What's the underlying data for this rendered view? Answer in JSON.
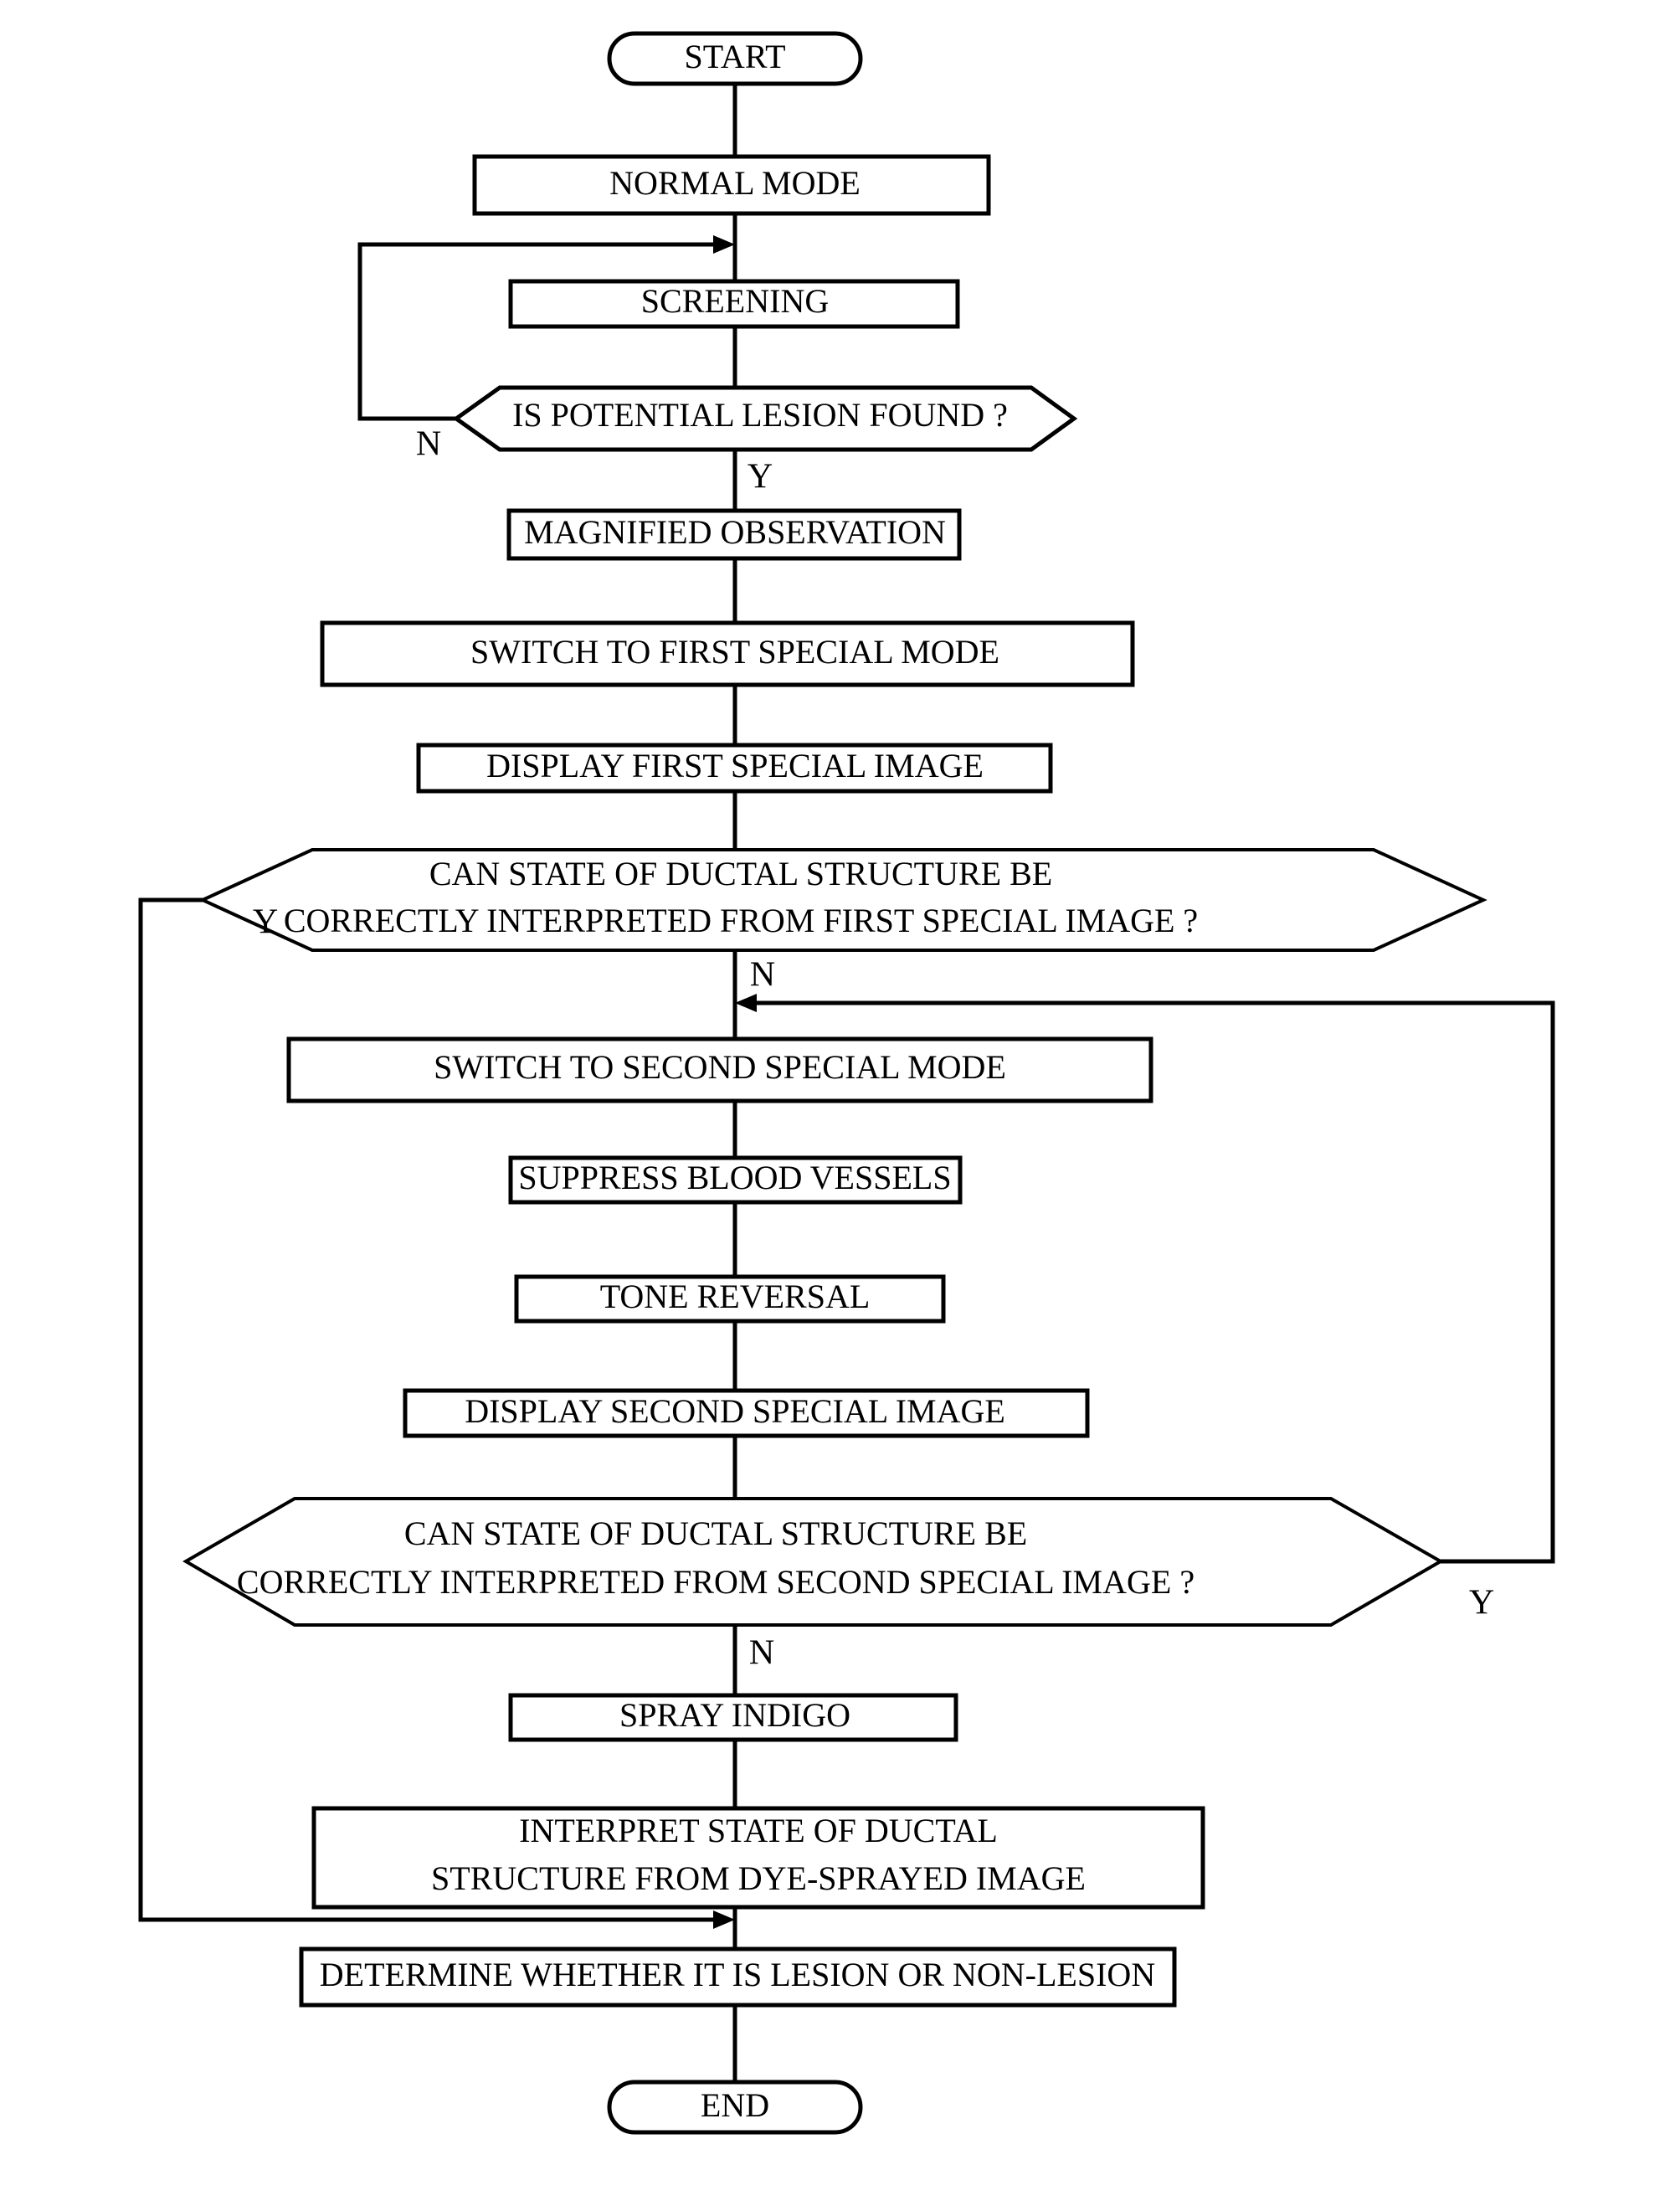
{
  "diagram": {
    "type": "flowchart",
    "title": "",
    "orientation": "top-to-bottom",
    "nodes": {
      "start": {
        "label": "START",
        "shape": "terminator"
      },
      "normal_mode": {
        "label": "NORMAL MODE",
        "shape": "process"
      },
      "screening": {
        "label": "SCREENING",
        "shape": "process"
      },
      "lesion_found": {
        "label": "IS POTENTIAL LESION FOUND ?",
        "shape": "decision"
      },
      "magnified": {
        "label": "MAGNIFIED OBSERVATION",
        "shape": "process"
      },
      "switch_first": {
        "label": "SWITCH TO FIRST SPECIAL MODE",
        "shape": "process"
      },
      "display_first": {
        "label": "DISPLAY FIRST SPECIAL IMAGE",
        "shape": "process"
      },
      "decide_first_l1": {
        "label": "CAN STATE OF DUCTAL STRUCTURE BE",
        "shape": "decision"
      },
      "decide_first_l2": {
        "label": "CORRECTLY INTERPRETED FROM FIRST SPECIAL IMAGE ?",
        "shape": "decision"
      },
      "switch_second": {
        "label": "SWITCH TO SECOND SPECIAL MODE",
        "shape": "process"
      },
      "suppress_vessels": {
        "label": "SUPPRESS BLOOD VESSELS",
        "shape": "process"
      },
      "tone_reversal": {
        "label": "TONE REVERSAL",
        "shape": "process"
      },
      "display_second": {
        "label": "DISPLAY SECOND SPECIAL IMAGE",
        "shape": "process"
      },
      "decide_second_l1": {
        "label": "CAN STATE OF DUCTAL STRUCTURE BE",
        "shape": "decision"
      },
      "decide_second_l2": {
        "label": "CORRECTLY INTERPRETED FROM SECOND SPECIAL IMAGE ?",
        "shape": "decision"
      },
      "spray_indigo": {
        "label": "SPRAY INDIGO",
        "shape": "process"
      },
      "interpret_l1": {
        "label": "INTERPRET STATE OF DUCTAL",
        "shape": "process"
      },
      "interpret_l2": {
        "label": "STRUCTURE FROM DYE-SPRAYED IMAGE",
        "shape": "process"
      },
      "determine": {
        "label": "DETERMINE WHETHER IT IS LESION OR NON-LESION",
        "shape": "process"
      },
      "end": {
        "label": "END",
        "shape": "terminator"
      }
    },
    "branch_labels": {
      "lesion_no": "N",
      "lesion_yes": "Y",
      "first_yes": "Y",
      "first_no": "N",
      "second_yes": "Y",
      "second_no": "N"
    },
    "colors": {
      "stroke": "#000000",
      "fill": "#ffffff",
      "text": "#000000"
    }
  }
}
